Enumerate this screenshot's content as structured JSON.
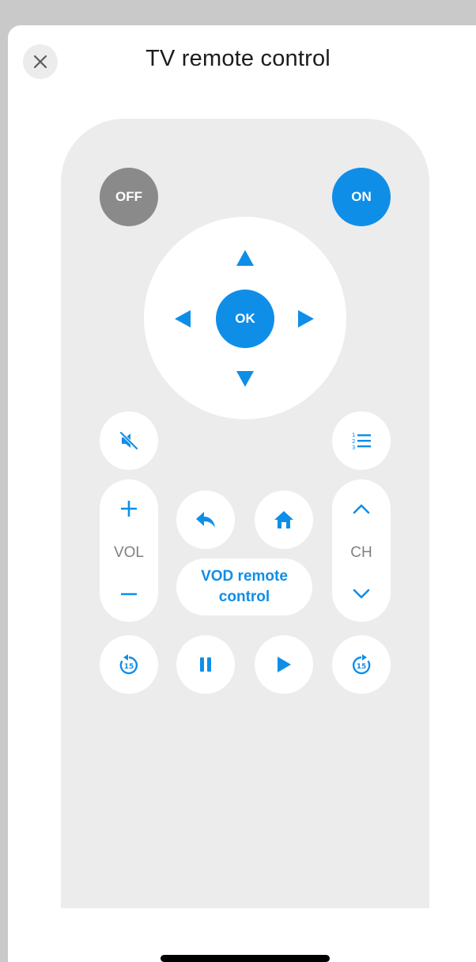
{
  "header": {
    "title": "TV remote control",
    "close_icon": "close-icon"
  },
  "power": {
    "off_label": "OFF",
    "on_label": "ON"
  },
  "dpad": {
    "ok_label": "OK",
    "icons": [
      "arrow-up-icon",
      "arrow-down-icon",
      "arrow-left-icon",
      "arrow-right-icon"
    ]
  },
  "volume": {
    "label": "VOL",
    "up_icon": "plus-icon",
    "down_icon": "minus-icon"
  },
  "channel": {
    "label": "CH",
    "up_icon": "chevron-up-icon",
    "down_icon": "chevron-down-icon"
  },
  "vod": {
    "line1": "VOD remote",
    "line2": "control"
  },
  "icons": {
    "mute": "mute-icon",
    "guide": "numbered-list-icon",
    "back": "back-icon",
    "home": "home-icon",
    "rewind": "rewind-15-icon",
    "pause": "pause-icon",
    "play": "play-icon",
    "forward": "forward-15-icon"
  },
  "colors": {
    "accent": "#0f8ee8",
    "off_button": "#8a8a8a",
    "remote_body": "#ececec",
    "label_gray": "#808080"
  }
}
